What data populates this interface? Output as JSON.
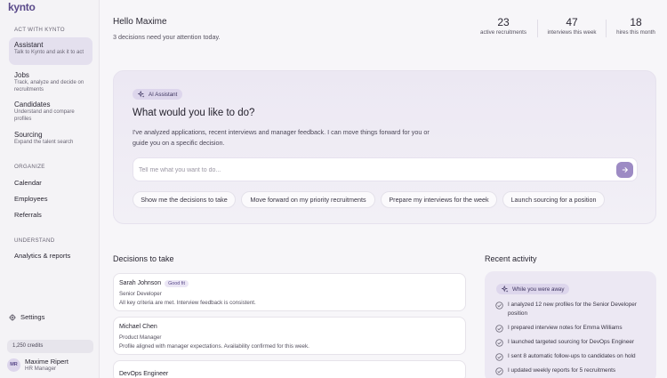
{
  "app": {
    "logo": "kynto"
  },
  "sidebar": {
    "section_act": "ACT WITH KYNTO",
    "section_organize": "ORGANIZE",
    "section_understand": "UNDERSTAND",
    "act_items": [
      {
        "label": "Assistant",
        "sub": "Talk to Kynto and ask it to act"
      },
      {
        "label": "Jobs",
        "sub": "Track, analyze and decide on recruitments"
      },
      {
        "label": "Candidates",
        "sub": "Understand and compare profiles"
      },
      {
        "label": "Sourcing",
        "sub": "Expand the talent search"
      }
    ],
    "organize_items": [
      "Calendar",
      "Employees",
      "Referrals"
    ],
    "understand_items": [
      "Analytics & reports"
    ],
    "settings": "Settings",
    "credits": "1,250 credits",
    "user": {
      "initials": "MR",
      "name": "Maxime Ripert",
      "role": "HR Manager"
    }
  },
  "header": {
    "greeting": "Hello Maxime",
    "subtitle": "3 decisions need your attention today.",
    "stats": [
      {
        "value": "23",
        "label": "active recruitments"
      },
      {
        "value": "47",
        "label": "interviews this week"
      },
      {
        "value": "18",
        "label": "hires this month"
      }
    ]
  },
  "assistant": {
    "badge": "AI Assistant",
    "title": "What would you like to do?",
    "description": "I've analyzed applications, recent interviews and manager feedback. I can move things forward for you or guide you on a specific decision.",
    "placeholder": "Tell me what you want to do...",
    "chips": [
      "Show me the decisions to take",
      "Move forward on my priority recruitments",
      "Prepare my interviews for the week",
      "Launch sourcing for a position"
    ]
  },
  "decisions": {
    "title": "Decisions to take",
    "items": [
      {
        "name": "Sarah Johnson",
        "tag": "Good fit",
        "role": "Senior Developer",
        "note": "All key criteria are met. Interview feedback is consistent."
      },
      {
        "name": "Michael Chen",
        "tag": "",
        "role": "Product Manager",
        "note": "Profile aligned with manager expectations. Availability confirmed for this week."
      },
      {
        "name": "DevOps Engineer",
        "tag": "",
        "role": "",
        "note": ""
      }
    ]
  },
  "activity": {
    "title": "Recent activity",
    "badge": "While you were away",
    "items": [
      "I analyzed 12 new profiles for the Senior Developer position",
      "I prepared interview notes for Emma Williams",
      "I launched targeted sourcing for DevOps Engineer",
      "I sent 8 automatic follow-ups to candidates on hold",
      "I updated weekly reports for 5 recruitments"
    ]
  },
  "colors": {
    "accent": "#9d8bc4",
    "brand": "#5a4a8a",
    "active_nav": "#e4e0ee"
  }
}
